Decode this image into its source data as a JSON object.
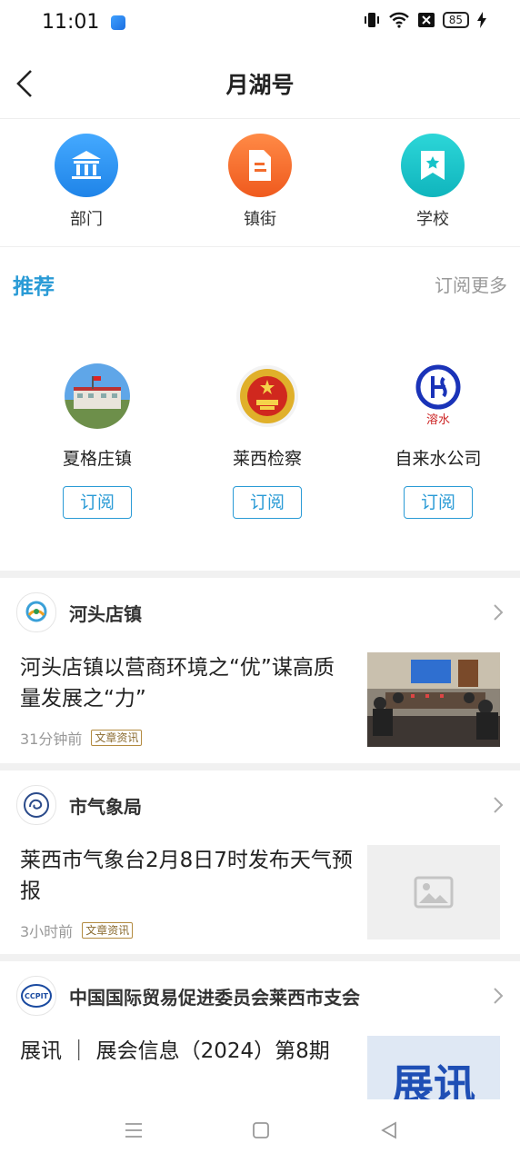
{
  "status": {
    "time": "11:01",
    "battery": "85"
  },
  "header": {
    "title": "月湖号"
  },
  "categories": [
    {
      "label": "部门",
      "icon": "building-icon",
      "color": "#2f9bf0"
    },
    {
      "label": "镇街",
      "icon": "document-icon",
      "color": "#f36b2c"
    },
    {
      "label": "学校",
      "icon": "star-bookmark-icon",
      "color": "#17c3c9"
    }
  ],
  "recommend": {
    "heading": "推荐",
    "more": "订阅更多",
    "items": [
      {
        "name": "夏格庄镇",
        "button": "订阅"
      },
      {
        "name": "莱西检察",
        "button": "订阅"
      },
      {
        "name": "自来水公司",
        "button": "订阅",
        "logo_text": "溶水"
      }
    ]
  },
  "articles": [
    {
      "source": "河头店镇",
      "title": "河头店镇以营商环境之“优”谋高质量发展之“力”",
      "time": "31分钟前",
      "tag": "文章资讯"
    },
    {
      "source": "市气象局",
      "title": "莱西市气象台2月8日7时发布天气预报",
      "time": "3小时前",
      "tag": "文章资讯"
    },
    {
      "source": "中国国际贸易促进委员会莱西市支会",
      "title": "展讯 ｜ 展会信息（2024）第8期",
      "thumb_text": "展讯",
      "avatar_text": "CCPIT"
    }
  ]
}
